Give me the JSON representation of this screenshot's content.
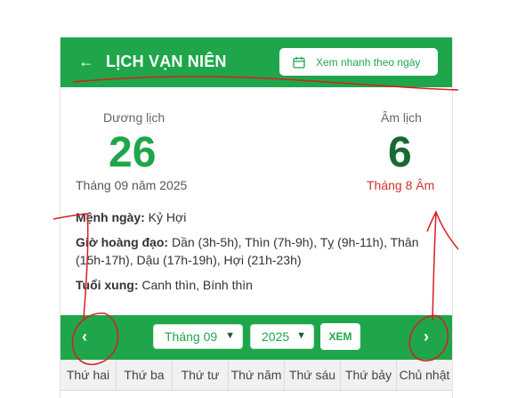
{
  "header": {
    "title": "LỊCH VẠN NIÊN",
    "quick_view_label": "Xem nhanh theo ngày"
  },
  "solar": {
    "label": "Dương lịch",
    "day": "26",
    "month_year": "Tháng 09 năm 2025"
  },
  "lunar": {
    "label": "Âm lịch",
    "day": "6",
    "month": "Tháng 8 Âm"
  },
  "details": {
    "day_label": "Mệnh ngày:",
    "day_value": "Kỷ Hợi",
    "hours_label": "Giờ hoàng đạo:",
    "hours_value": "Dần (3h-5h), Thìn (7h-9h), Tỵ (9h-11h), Thân (15h-17h), Dậu (17h-19h), Hợi (21h-23h)",
    "conflict_label": "Tuổi xung:",
    "conflict_value": "Canh thìn, Bính thìn"
  },
  "calendar": {
    "month_select": "Tháng 09",
    "year_select": "2025",
    "view_button": "XEM",
    "weekdays": [
      "Thứ hai",
      "Thứ ba",
      "Thứ tư",
      "Thứ năm",
      "Thứ sáu",
      "Thứ bảy",
      "Chủ nhật"
    ]
  },
  "colors": {
    "brand_green": "#1fa64a",
    "lunar_day": "#156b31",
    "lunar_month": "#d0312d",
    "annotation_red": "#d61f1f"
  }
}
